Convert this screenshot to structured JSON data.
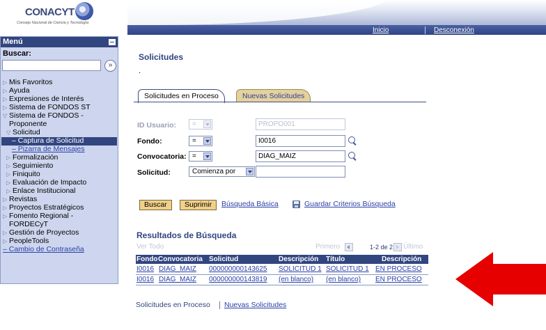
{
  "header": {
    "brand": "CONACYT",
    "subtitle": "Consejo Nacional de Ciencia y Tecnología",
    "nav": [
      "Inicio",
      "Desconexión"
    ]
  },
  "sidebar": {
    "title": "Menú",
    "search_label": "Buscar:",
    "search_value": "",
    "items": [
      {
        "label": "Mis Favoritos"
      },
      {
        "label": "Ayuda"
      },
      {
        "label": "Expresiones de Interés"
      },
      {
        "label": "Sistema de FONDOS ST"
      },
      {
        "label": "Sistema de FONDOS -"
      },
      {
        "label": "Proponente"
      },
      {
        "label": "Solicitud"
      },
      {
        "label": "Captura de Solicitud"
      },
      {
        "label": "Pizarra de Mensajes"
      },
      {
        "label": "Formalización"
      },
      {
        "label": "Seguimiento"
      },
      {
        "label": "Finiquito"
      },
      {
        "label": "Evaluación de Impacto"
      },
      {
        "label": "Enlace Institucional"
      },
      {
        "label": "Revistas"
      },
      {
        "label": "Proyectos Estratégicos"
      },
      {
        "label": "Fomento Regional -"
      },
      {
        "label": "FORDECyT"
      },
      {
        "label": "Gestión de Proyectos"
      },
      {
        "label": "PeopleTools"
      },
      {
        "label": "Cambio de Contraseña"
      }
    ]
  },
  "main": {
    "title": "Solicitudes",
    "dot": ".",
    "tabs": [
      "Solicitudes en Proceso",
      "Nuevas Solicitudes"
    ],
    "fields": {
      "id_usuario": {
        "label": "ID Usuario:",
        "op": "=",
        "value": "PROPO001"
      },
      "fondo": {
        "label": "Fondo:",
        "op": "=",
        "value": "I0016"
      },
      "convocatoria": {
        "label": "Convocatoria:",
        "op": "=",
        "value": "DIAG_MAIZ"
      },
      "solicitud": {
        "label": "Solicitud:",
        "op": "Comienza por",
        "value": ""
      }
    },
    "buttons": {
      "buscar": "Buscar",
      "suprimir": "Suprimir",
      "busqueda_basica": "Búsqueda Básica",
      "guardar": "Guardar Criterios Búsqueda"
    },
    "results": {
      "title": "Resultados de Búsqueda",
      "ver_todo": "Ver Todo",
      "primero": "Primero",
      "count": "1-2 de 2",
      "ultimo": "Último",
      "columns": [
        "Fondo",
        "Convocatoria",
        "Solicitud",
        "Descripción",
        "Título",
        "Descripción"
      ],
      "rows": [
        [
          "I0016",
          "DIAG_MAIZ",
          "000000000143625",
          "SOLICITUD 1",
          "SOLICITUD 1",
          "EN PROCESO"
        ],
        [
          "I0016",
          "DIAG_MAIZ",
          "000000000143819",
          "(en blanco)",
          "(en blanco)",
          "EN PROCESO"
        ]
      ]
    },
    "bottom_links": [
      "Solicitudes en Proceso",
      "Nuevas Solicitudes"
    ]
  },
  "colors": {
    "menu_header": "#31457f",
    "link": "#2b40a6",
    "tab_inactive": "#e5d19b",
    "button": "#f0d08a",
    "arrow": "#e60000"
  }
}
